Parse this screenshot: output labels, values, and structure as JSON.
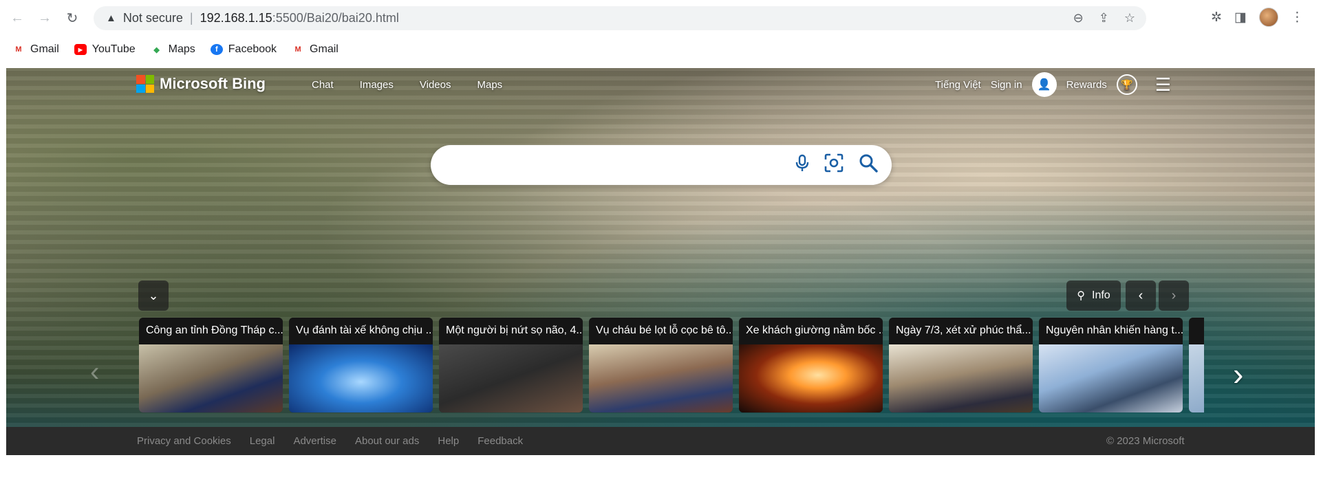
{
  "browser": {
    "security_label": "Not secure",
    "url_host": "192.168.1.15",
    "url_path": ":5500/Bai20/bai20.html"
  },
  "bookmarks": [
    {
      "label": "Gmail",
      "icon": "gmail-icon"
    },
    {
      "label": "YouTube",
      "icon": "youtube-icon"
    },
    {
      "label": "Maps",
      "icon": "maps-icon"
    },
    {
      "label": "Facebook",
      "icon": "facebook-icon"
    },
    {
      "label": "Gmail",
      "icon": "gmail-icon"
    }
  ],
  "header": {
    "logo_text": "Microsoft Bing",
    "nav": [
      "Chat",
      "Images",
      "Videos",
      "Maps"
    ],
    "language": "Tiếng Việt",
    "sign_in": "Sign in",
    "rewards": "Rewards"
  },
  "search": {
    "placeholder": ""
  },
  "info": {
    "label": "Info"
  },
  "news": [
    {
      "title": "Công an tỉnh Đồng Tháp c..."
    },
    {
      "title": "Vụ đánh tài xế không chịu ..."
    },
    {
      "title": "Một người bị nứt sọ não, 4..."
    },
    {
      "title": "Vụ cháu bé lọt lỗ cọc bê tô..."
    },
    {
      "title": "Xe khách giường nằm bốc ..."
    },
    {
      "title": "Ngày 7/3, xét xử phúc thẩ..."
    },
    {
      "title": "Nguyên nhân khiến hàng t..."
    },
    {
      "title": ""
    }
  ],
  "footer": {
    "links": [
      "Privacy and Cookies",
      "Legal",
      "Advertise",
      "About our ads",
      "Help",
      "Feedback"
    ],
    "copyright": "© 2023 Microsoft"
  },
  "colors": {
    "brand_red": "#f25022",
    "brand_green": "#7fba00",
    "brand_blue": "#00a4ef",
    "brand_yellow": "#ffb900",
    "search_icon_blue": "#1a5fa5",
    "footer_bg": "#2b2b2b"
  }
}
